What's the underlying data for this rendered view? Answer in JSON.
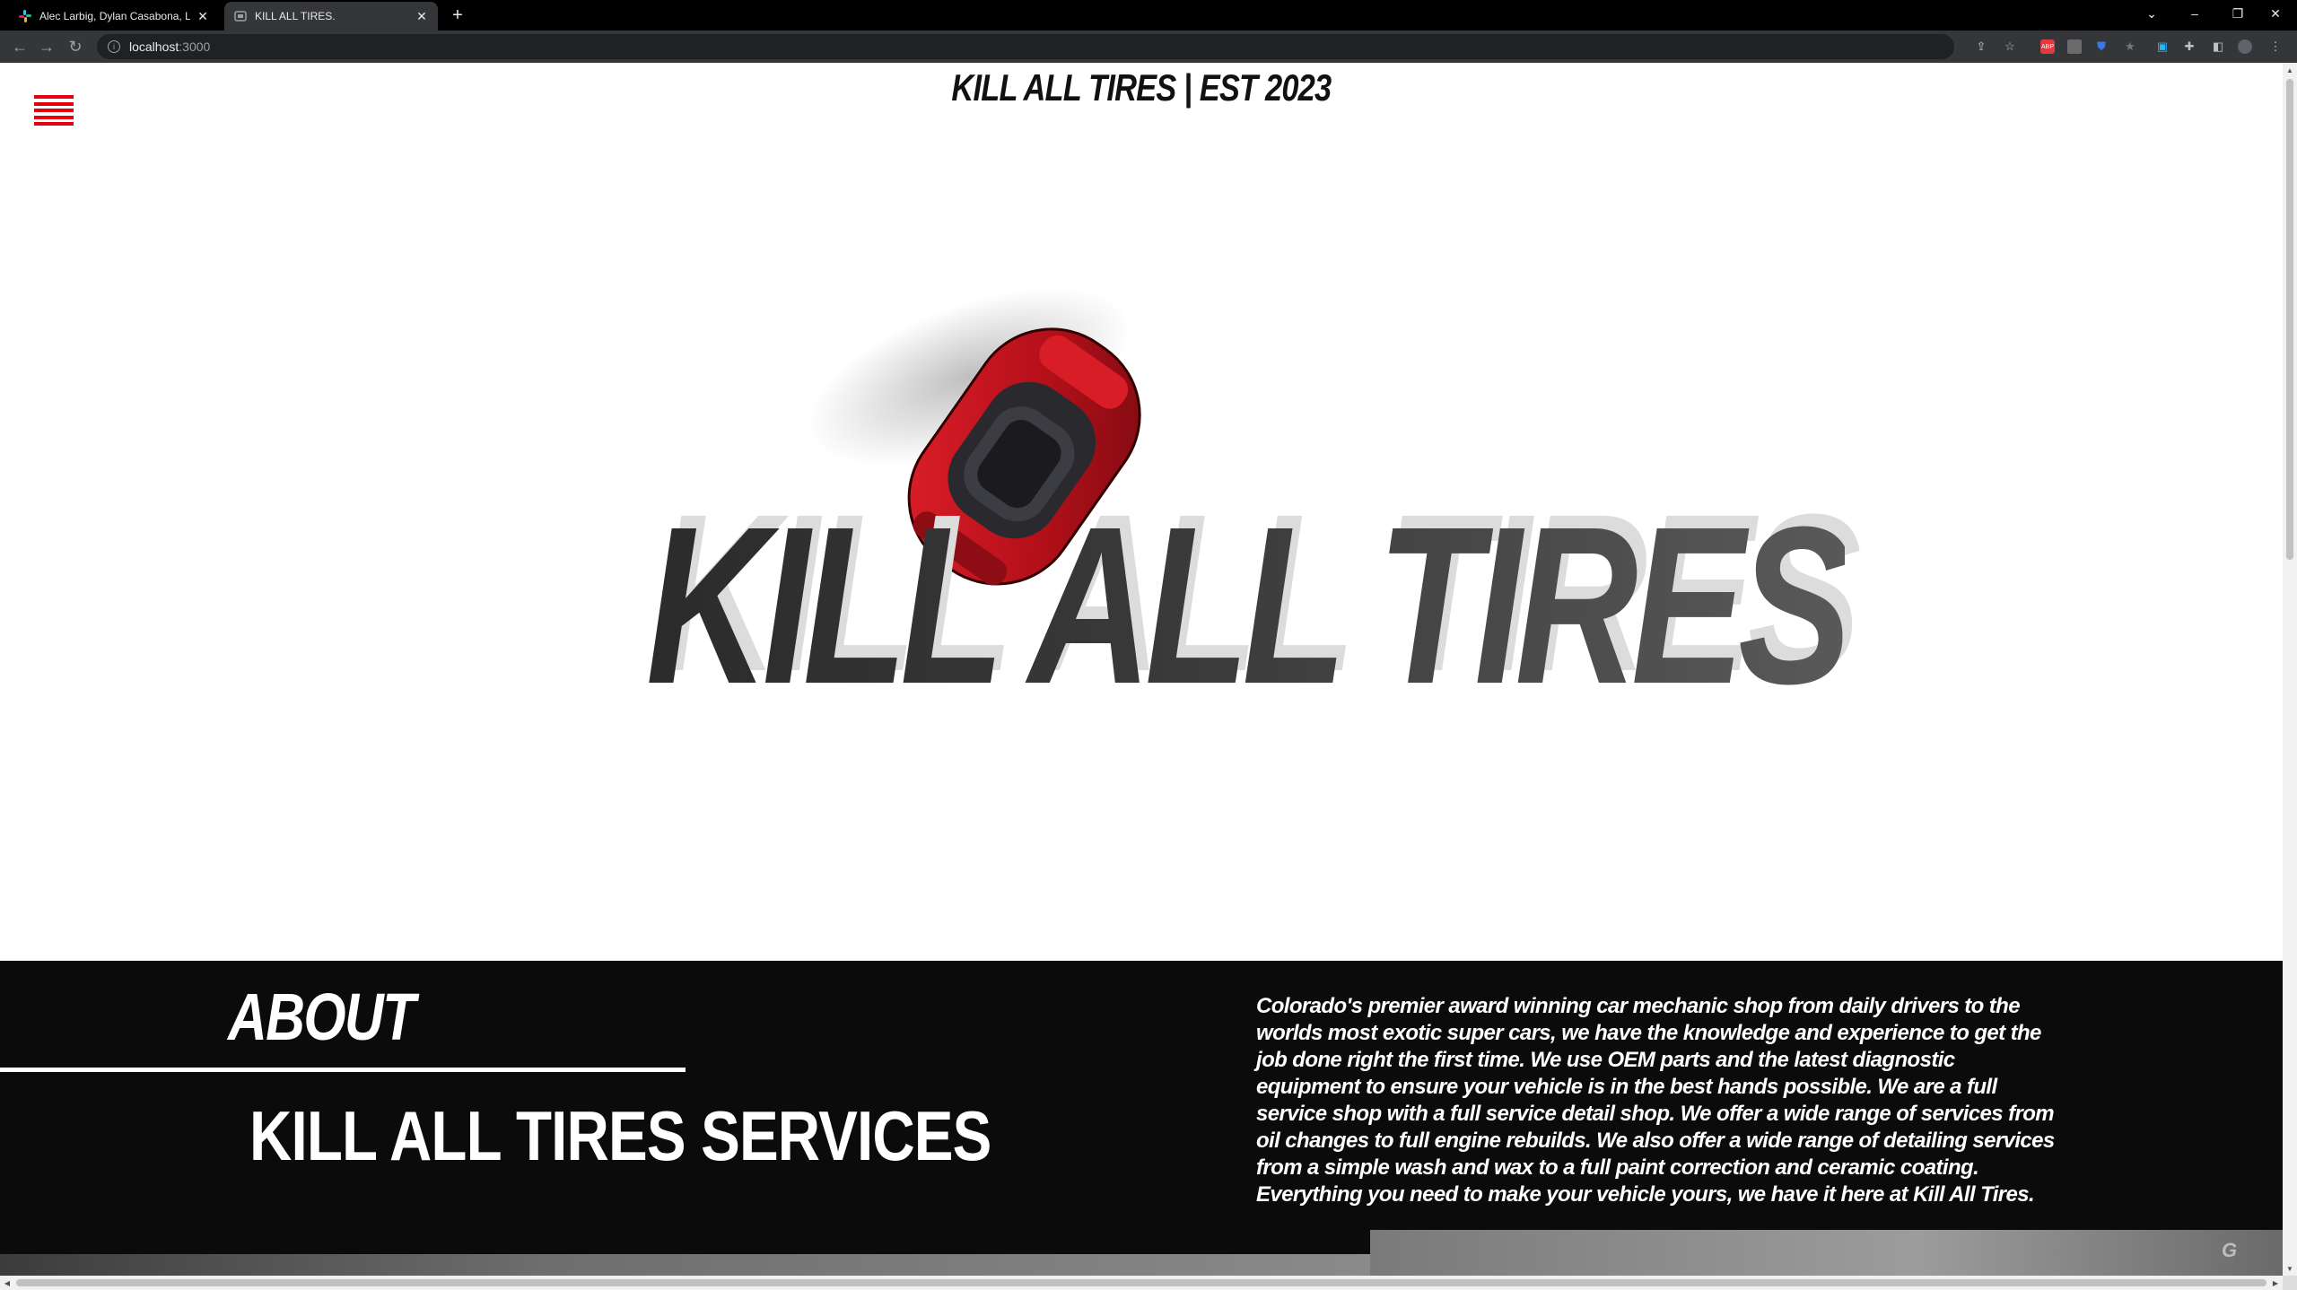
{
  "browser": {
    "tabs": [
      {
        "title": "Alec Larbig, Dylan Casabona, Log",
        "active": false
      },
      {
        "title": "KILL ALL TIRES.",
        "active": true
      }
    ],
    "new_tab_symbol": "+",
    "url_host": "localhost",
    "url_port": ":3000"
  },
  "page": {
    "brand_header": "KILL ALL TIRES | EST 2023",
    "hero_text": "KILL ALL TIRES",
    "about": {
      "heading": "ABOUT",
      "services_heading": "KILL ALL TIRES SERVICES",
      "body": "Colorado's premier award winning car mechanic shop from daily drivers to the worlds most exotic super cars, we have the knowledge and experience to get the job done right the first time. We use OEM parts and the latest diagnostic equipment to ensure your vehicle is in the best hands possible. We are a full service shop with a full service detail shop. We offer a wide range of services from oil changes to full engine rebuilds. We also offer a wide range of detailing services from a simple wash and wax to a full paint correction and ceramic coating. Everything you need to make your vehicle yours, we have it here at Kill All Tires."
    }
  },
  "colors": {
    "accent_red": "#e3000f",
    "about_bg": "#0b0b0b",
    "hero_text_dark": "#2b2b2b",
    "car_red": "#c8101a"
  },
  "icons": [
    "slack-favicon",
    "site-favicon",
    "close-icon",
    "back-icon",
    "forward-icon",
    "reload-icon",
    "info-icon",
    "share-icon",
    "bookmark-star-icon",
    "extensions-icon",
    "side-panel-icon",
    "profile-avatar",
    "menu-dots-icon",
    "hamburger-menu-icon"
  ]
}
